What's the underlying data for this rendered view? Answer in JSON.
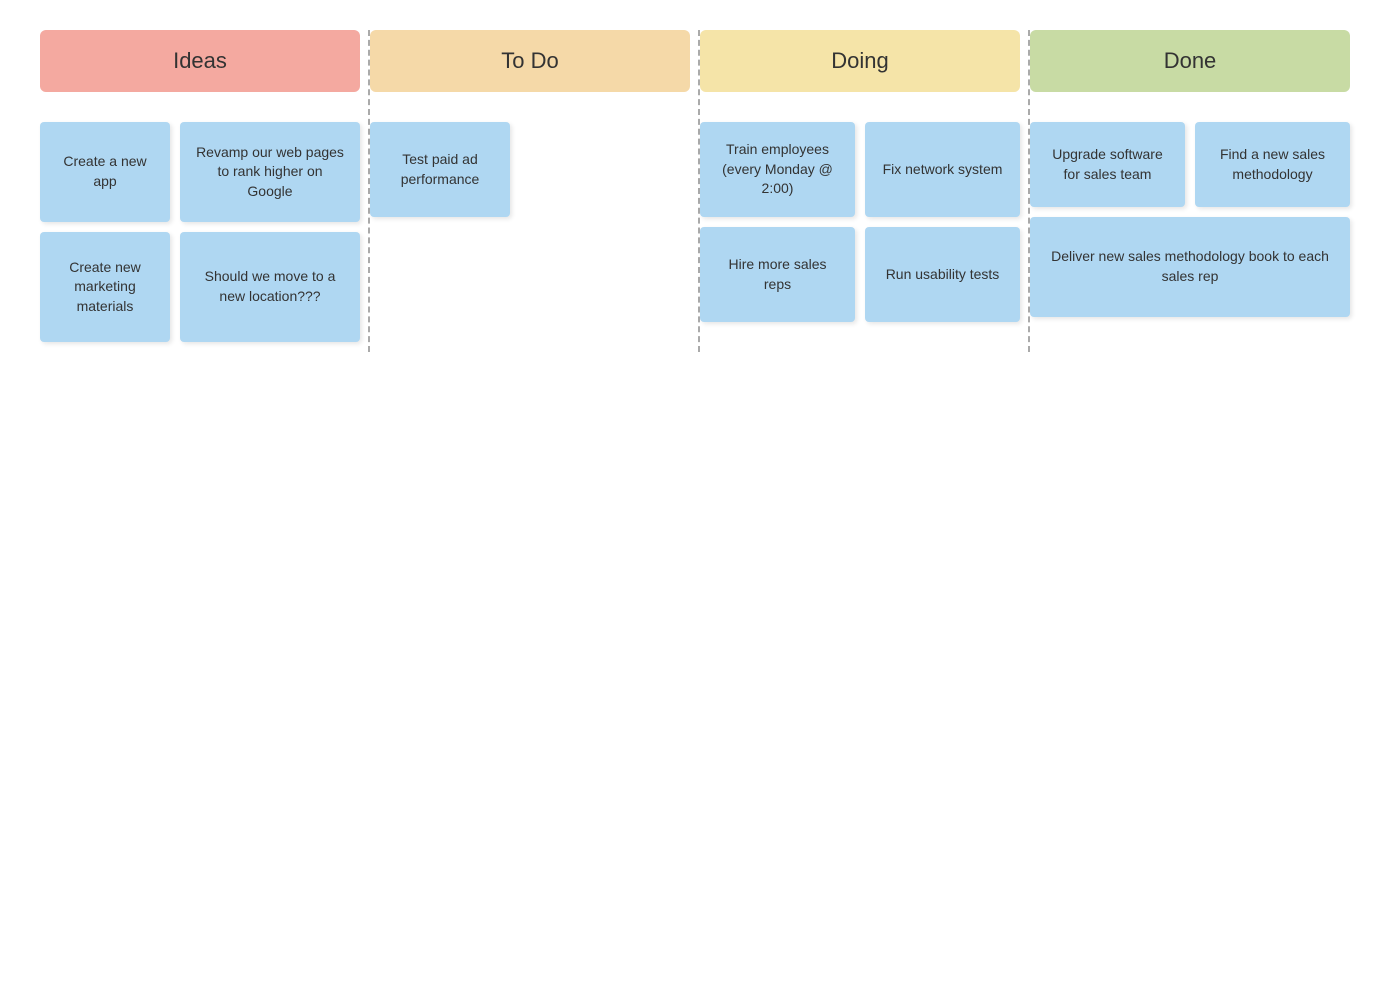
{
  "columns": [
    {
      "id": "ideas",
      "label": "Ideas",
      "cards_rows": [
        [
          {
            "text": "Create a new app"
          },
          {
            "text": "Revamp our web pages to rank higher on Google"
          }
        ],
        [
          {
            "text": "Create new marketing materials"
          },
          {
            "text": "Should we move to a new location???"
          }
        ]
      ]
    },
    {
      "id": "todo",
      "label": "To Do",
      "cards_rows": [
        [
          {
            "text": "Test paid ad performance"
          }
        ]
      ]
    },
    {
      "id": "doing",
      "label": "Doing",
      "cards_rows": [
        [
          {
            "text": "Train employees (every Monday @ 2:00)"
          },
          {
            "text": "Fix network system"
          }
        ],
        [
          {
            "text": "Hire more sales reps"
          },
          {
            "text": "Run usability tests"
          }
        ]
      ]
    },
    {
      "id": "done",
      "label": "Done",
      "cards_rows": [
        [
          {
            "text": "Upgrade software for sales team"
          },
          {
            "text": "Find a new sales methodology"
          }
        ],
        [
          {
            "text": "Deliver new sales methodology book to each sales rep"
          }
        ]
      ]
    }
  ]
}
